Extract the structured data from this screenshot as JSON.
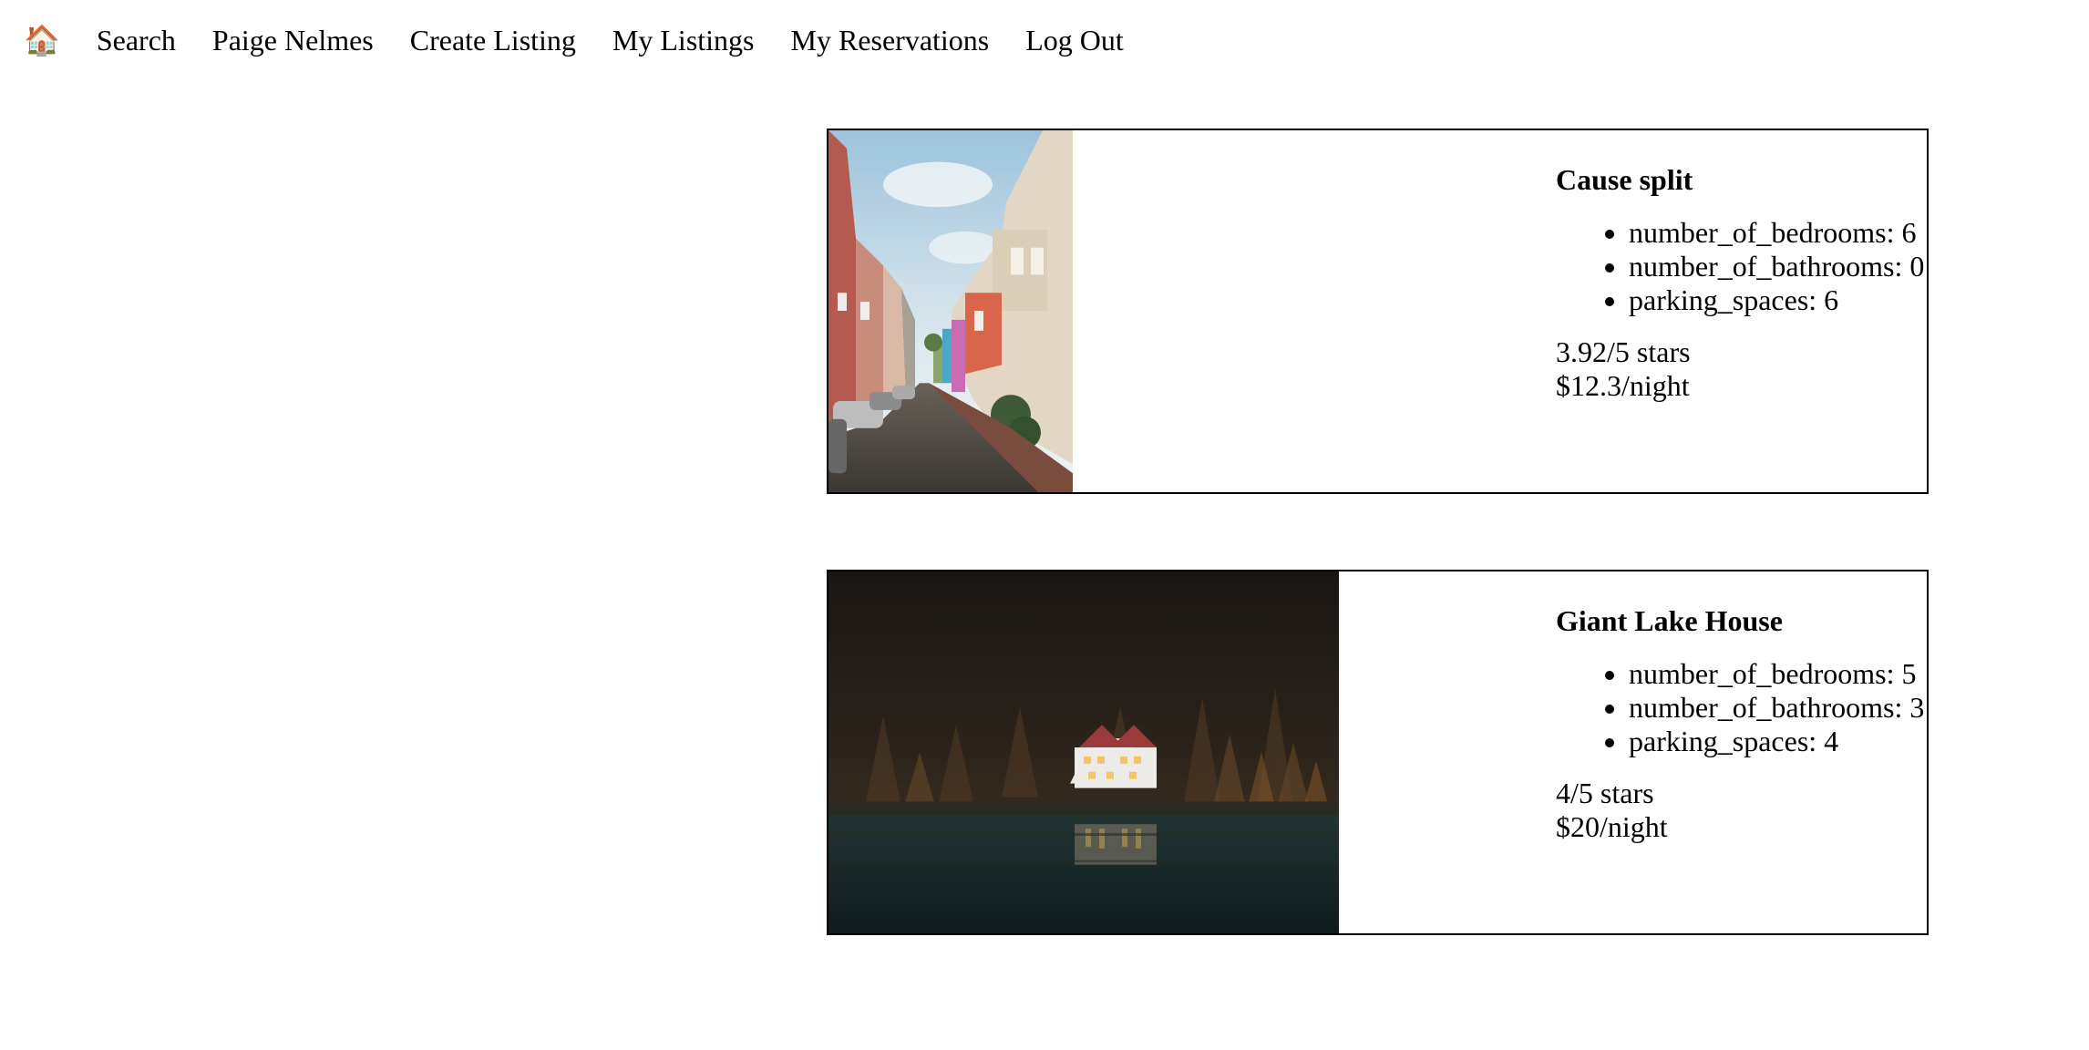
{
  "nav": {
    "home_icon": "🏠",
    "home_icon_name": "house-icon",
    "items": [
      {
        "label": "Search"
      },
      {
        "label": "Paige Nelmes"
      },
      {
        "label": "Create Listing"
      },
      {
        "label": "My Listings"
      },
      {
        "label": "My Reservations"
      },
      {
        "label": "Log Out"
      }
    ]
  },
  "listings": [
    {
      "title": "Cause split",
      "features": [
        "number_of_bedrooms: 6",
        "number_of_bathrooms: 0",
        "parking_spaces: 6"
      ],
      "rating": "3.92/5 stars",
      "price": "$12.3/night"
    },
    {
      "title": "Giant Lake House",
      "features": [
        "number_of_bedrooms: 5",
        "number_of_bathrooms: 3",
        "parking_spaces: 4"
      ],
      "rating": "4/5 stars",
      "price": "$20/night"
    }
  ]
}
